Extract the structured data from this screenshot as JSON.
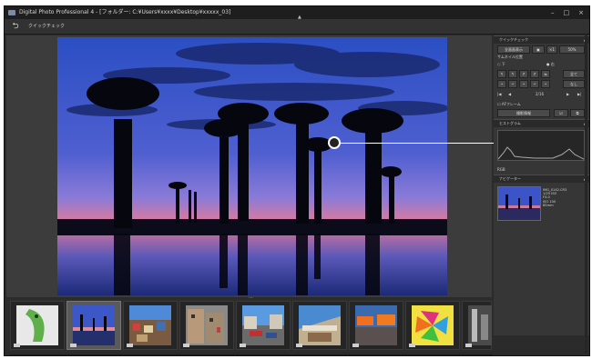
{
  "window": {
    "title": "Digital Photo Professional 4 - [フォルダー: C:¥Users¥xxxx¥Desktop¥xxxxx_03]",
    "controls": [
      "–",
      "□",
      "×"
    ]
  },
  "toolbar": {
    "back_glyph": "⮌",
    "quick_check_label": "クイックチェック"
  },
  "panel": {
    "quick_check_title": "クイックチェック",
    "fit_label": "全画面表示",
    "zoom_value": "50%",
    "thumb_position_label": "サムネイル位置",
    "position_bottom": "下",
    "position_right": "右",
    "rating_all": "全て",
    "rating_none": "なし",
    "page_indicator": "2/16",
    "af_frame": "AFフレーム",
    "info_label": "撮影情報",
    "histogram_title": "ヒストグラム",
    "histogram_scale": "RGB",
    "navigator_title": "ナビゲーター",
    "nav_info": [
      "IMG_0142.CR3",
      "1/25  ISO",
      "F4.0",
      "ISO 100",
      "85mm"
    ]
  },
  "thumbnails": [
    {
      "name": "chameleon",
      "selected": false
    },
    {
      "name": "baobab-sunset",
      "selected": true
    },
    {
      "name": "hillside-town",
      "selected": false
    },
    {
      "name": "old-buildings",
      "selected": false
    },
    {
      "name": "street-cars",
      "selected": false
    },
    {
      "name": "street-market",
      "selected": false
    },
    {
      "name": "orange-umbrellas",
      "selected": false
    },
    {
      "name": "colorful-pinwheels",
      "selected": false
    },
    {
      "name": "machinery",
      "selected": false
    }
  ],
  "colors": {
    "accent": "#2e6fd0",
    "chrome": "#2b2b2b"
  }
}
